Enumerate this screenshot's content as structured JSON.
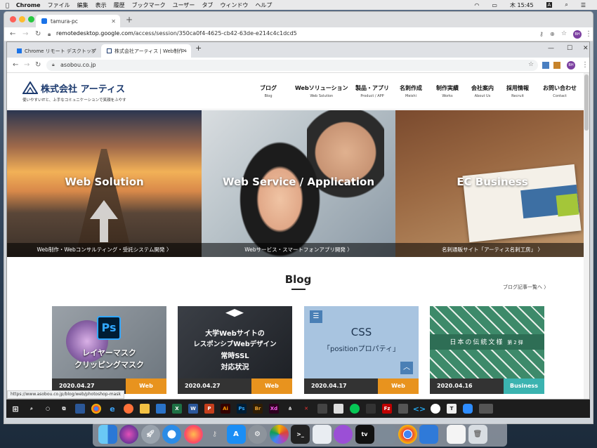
{
  "mac_menubar": {
    "app": "Chrome",
    "items": [
      "ファイル",
      "編集",
      "表示",
      "履歴",
      "ブックマーク",
      "ユーザー",
      "タブ",
      "ウィンドウ",
      "ヘルプ"
    ],
    "clock": "木 15:45"
  },
  "outer_browser": {
    "tab_title": "tamura-pc",
    "url_host": "remotedesktop.google.com",
    "url_path": "/access/session/350ca0f4-4625-cb42-63de-e214c4c1dcd5",
    "profile": "BH"
  },
  "inner_browser": {
    "tabs": [
      {
        "title": "Chrome リモート デスクトップ"
      },
      {
        "title": "株式会社アーティス | Web制作・シ..."
      }
    ],
    "url": "asobou.co.jp",
    "profile": "BH"
  },
  "site": {
    "logo_name": "株式会社 アーティス",
    "logo_tagline": "使いやすいITと、上手なコミュニケーションで笑顔をふやす",
    "nav": [
      {
        "jp": "ブログ",
        "en": "Blog"
      },
      {
        "jp": "Webソリューション",
        "en": "Web Solution"
      },
      {
        "jp": "製品・アプリ",
        "en": "Product / APP"
      },
      {
        "jp": "名刺作成",
        "en": "Meishi"
      },
      {
        "jp": "制作実績",
        "en": "Works"
      },
      {
        "jp": "会社案内",
        "en": "About Us"
      },
      {
        "jp": "採用情報",
        "en": "Recruit"
      },
      {
        "jp": "お問い合わせ",
        "en": "Contact"
      }
    ],
    "hero": [
      {
        "title": "Web Solution",
        "caption": "Web制作・Webコンサルティング・受託システム開発 〉"
      },
      {
        "title": "Web Service / Application",
        "caption": "Webサービス・スマートフォンアプリ開発 〉"
      },
      {
        "title": "EC Business",
        "caption": "名刺通販サイト「アーティス名刺工房」 〉"
      }
    ],
    "blog_heading": "Blog",
    "blog_more": "ブログ記事一覧へ 〉",
    "cards": [
      {
        "line1": "レイヤーマスク",
        "line2": "クリッピングマスク",
        "date": "2020.04.27",
        "category": "Web",
        "cat_color": "#e8931e",
        "badge": "Ps"
      },
      {
        "line1": "大学Webサイトの",
        "line2": "レスポンシブWebデザイン",
        "line3": "常時SSL",
        "line4": "対応状況",
        "date": "2020.04.27",
        "category": "Web",
        "cat_color": "#e8931e"
      },
      {
        "line1": "CSS",
        "line2": "「positionプロパティ」",
        "date": "2020.04.17",
        "category": "Web",
        "cat_color": "#e8931e"
      },
      {
        "line1": "日本の伝統文様",
        "line2": "第2弾",
        "date": "2020.04.16",
        "category": "Business",
        "cat_color": "#3bb3b0"
      }
    ],
    "status_url": "https://www.asobou.co.jp/blog/web/photoshop-mask"
  },
  "colors": {
    "brand": "#1c3a6e",
    "web_category": "#e8931e",
    "business_category": "#3bb3b0"
  }
}
